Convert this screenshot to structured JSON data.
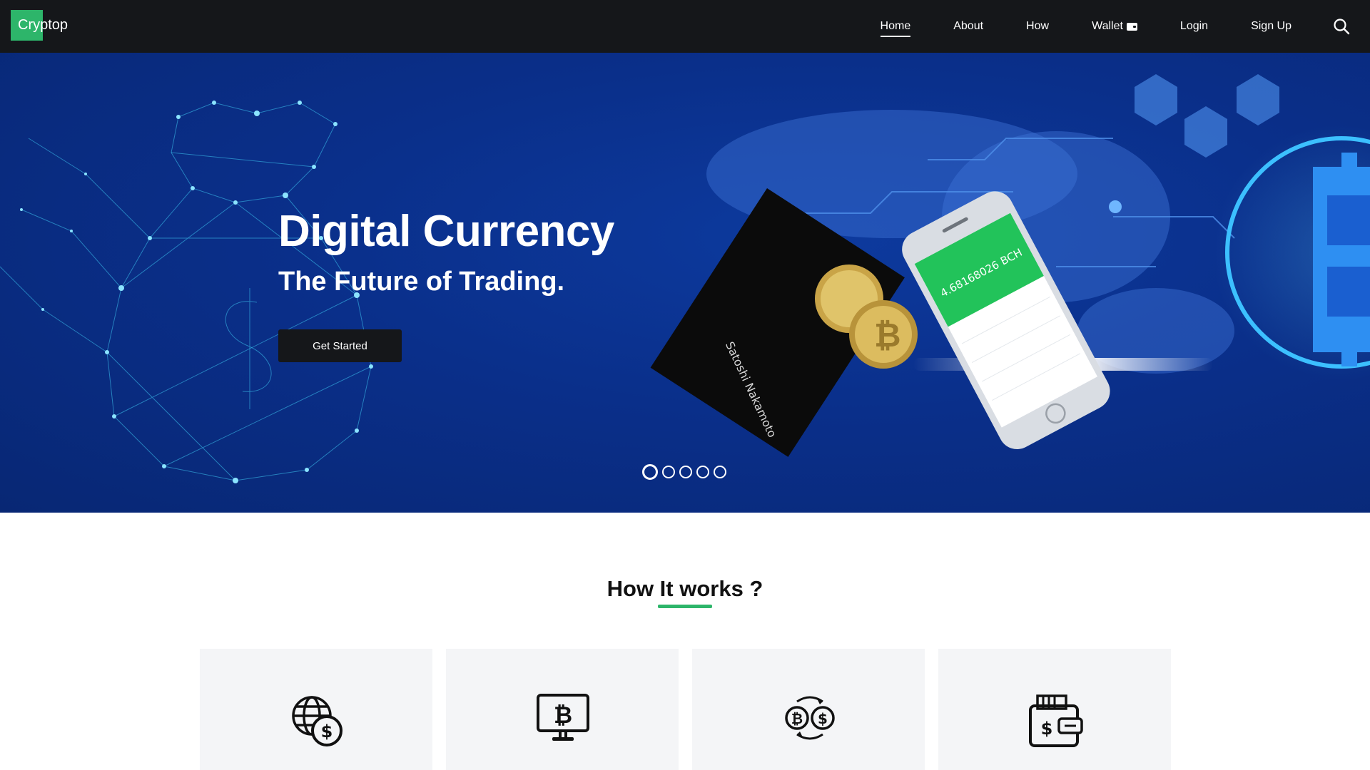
{
  "brand": {
    "name": "Cryptop"
  },
  "nav": {
    "items": [
      {
        "label": "Home",
        "active": true
      },
      {
        "label": "About"
      },
      {
        "label": "How"
      },
      {
        "label": "Wallet",
        "icon": "wallet-icon"
      },
      {
        "label": "Login"
      },
      {
        "label": "Sign Up"
      }
    ],
    "search_icon": "search-icon"
  },
  "hero": {
    "title": "Digital Currency",
    "subtitle": "The Future of Trading.",
    "cta_label": "Get Started",
    "device_balance": "4.68168026 BCH",
    "book_author": "Satoshi Nakamoto",
    "slides": 5,
    "active_slide": 1
  },
  "how_it_works": {
    "title": "How It works ?",
    "cards": [
      {
        "icon": "globe-dollar-icon"
      },
      {
        "icon": "monitor-bitcoin-icon"
      },
      {
        "icon": "exchange-bitcoin-dollar-icon"
      },
      {
        "icon": "wallet-dollar-icon"
      }
    ]
  },
  "colors": {
    "accent": "#2db56a",
    "nav_bg": "#15171a",
    "hero_bg": "#0a2f8a",
    "card_bg": "#f4f5f7"
  }
}
